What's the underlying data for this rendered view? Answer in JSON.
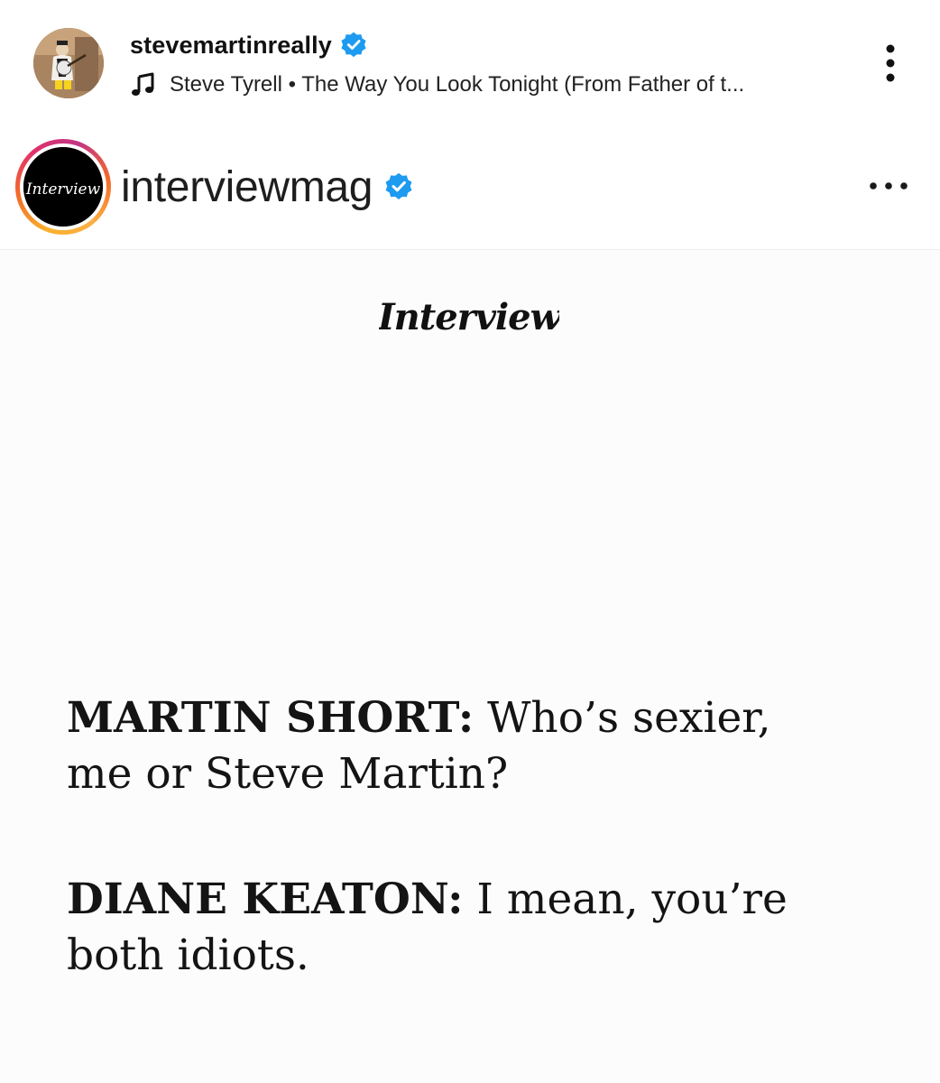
{
  "post": {
    "username": "stevemartinreally",
    "music_text": "Steve Tyrell • The Way You Look Tonight (From Father of t...",
    "verified": true,
    "icons": {
      "verified": "verified-badge-icon",
      "music": "music-note-icon",
      "more": "more-vertical-icon"
    }
  },
  "embed": {
    "username": "interviewmag",
    "avatar_wordmark": "Interview",
    "logo_wordmark": "Interview",
    "verified": true,
    "icons": {
      "verified": "verified-badge-icon",
      "more": "more-horizontal-icon"
    },
    "quotes": [
      {
        "speaker": "MARTIN SHORT:",
        "line_1": " Who’s sexier,",
        "line_2": "me or Steve Martin?"
      },
      {
        "speaker": "DIANE KEATON:",
        "line_1": " I mean, you’re",
        "line_2": "both idiots."
      }
    ]
  },
  "colors": {
    "verified_blue": "#1d9bf0",
    "text": "#111111"
  }
}
